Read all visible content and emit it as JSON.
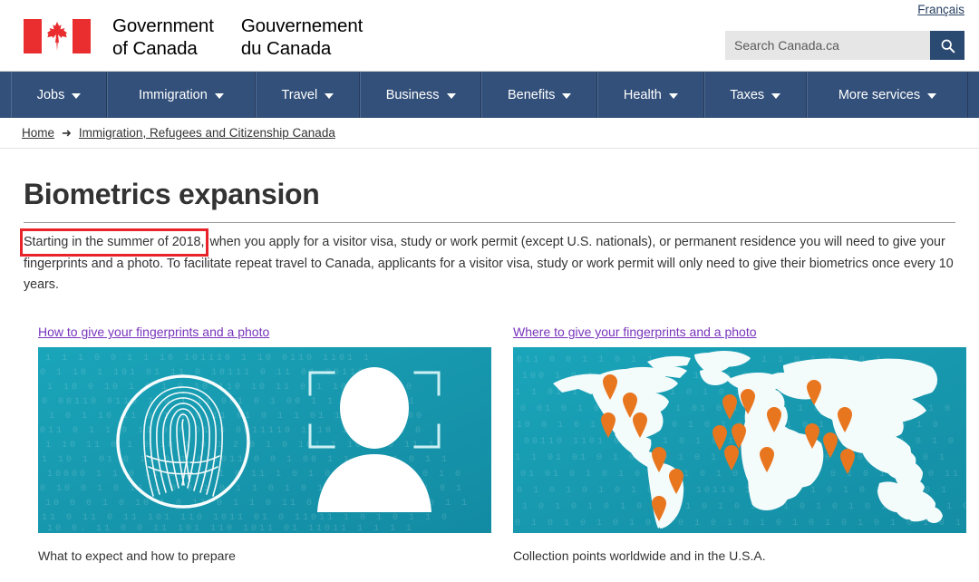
{
  "header": {
    "language_link": "Français",
    "brand_en": "Government\nof Canada",
    "brand_fr": "Gouvernement\ndu Canada",
    "flag_icon": "canada-flag-icon",
    "search": {
      "placeholder": "Search Canada.ca",
      "value": "",
      "button_icon": "search-icon",
      "button_color": "#2b4a72"
    }
  },
  "nav": {
    "background": "#33507a",
    "items": [
      {
        "label": "Jobs",
        "caret": "chevron-down-icon"
      },
      {
        "label": "Immigration",
        "caret": "chevron-down-icon"
      },
      {
        "label": "Travel",
        "caret": "chevron-down-icon"
      },
      {
        "label": "Business",
        "caret": "chevron-down-icon"
      },
      {
        "label": "Benefits",
        "caret": "chevron-down-icon"
      },
      {
        "label": "Health",
        "caret": "chevron-down-icon"
      },
      {
        "label": "Taxes",
        "caret": "chevron-down-icon"
      },
      {
        "label": "More services",
        "caret": "chevron-down-icon"
      }
    ]
  },
  "breadcrumb": {
    "home": "Home",
    "separator": "➜",
    "current": "Immigration, Refugees and Citizenship Canada"
  },
  "main": {
    "title": "Biometrics expansion",
    "intro_highlight": "Starting in the summer of 2018,",
    "intro_rest": " when you apply for a visitor visa, study or work permit (except U.S. nationals), or permanent residence you will need to give your fingerprints and a photo. To facilitate repeat travel to Canada, applicants for a visitor visa, study or work permit will only need to give their biometrics once every 10 years.",
    "highlight_color": "#e8242a",
    "cards": [
      {
        "link": "How to give your fingerprints and a photo",
        "caption": "What to expect and how to prepare",
        "image_name": "fingerprint-and-face-biometrics-image",
        "bg_color": "#19a0b5"
      },
      {
        "link": "Where to give your fingerprints and a photo",
        "caption": "Collection points worldwide and in the U.S.A.",
        "image_name": "world-map-collection-points-image",
        "bg_color": "#19a0b5",
        "pin_color": "#e8761f"
      }
    ]
  }
}
